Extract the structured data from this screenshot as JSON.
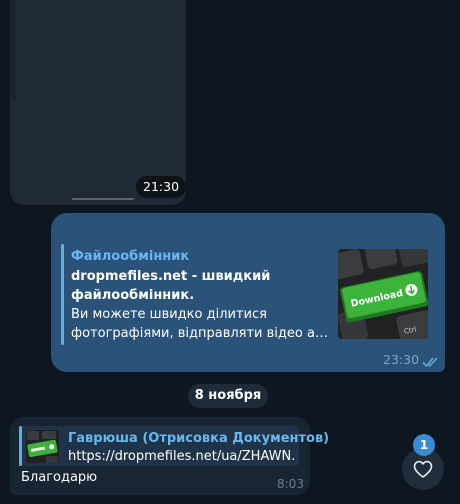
{
  "photo_message": {
    "time": "21:30"
  },
  "link_message": {
    "site_name": "Файлообмінник",
    "title": "dropmefiles.net - швидкий файлообмінник.",
    "description_line1": "Ви можете швидко ділитися",
    "description_line2": "фотографіями, відправляти відео або пе...",
    "thumbnail_key_label": "Download",
    "thumbnail_ctrl_label": "Ctrl",
    "time": "23:30",
    "status_icon": "double-check-icon"
  },
  "date_divider": {
    "label": "8 ноября"
  },
  "incoming_message": {
    "reply_name": "Гаврюша (Отрисовка Документов)",
    "reply_url": "https://dropmefiles.net/ua/ZHAWN...",
    "text": "Благодарю",
    "time": "8:03"
  },
  "reactions_button": {
    "count": "1",
    "icon": "heart-icon"
  },
  "colors": {
    "background": "#0e1621",
    "outgoing_bubble": "#2b5278",
    "incoming_bubble": "#182533",
    "accent": "#6ab7f0",
    "download_green": "#3db33b"
  }
}
